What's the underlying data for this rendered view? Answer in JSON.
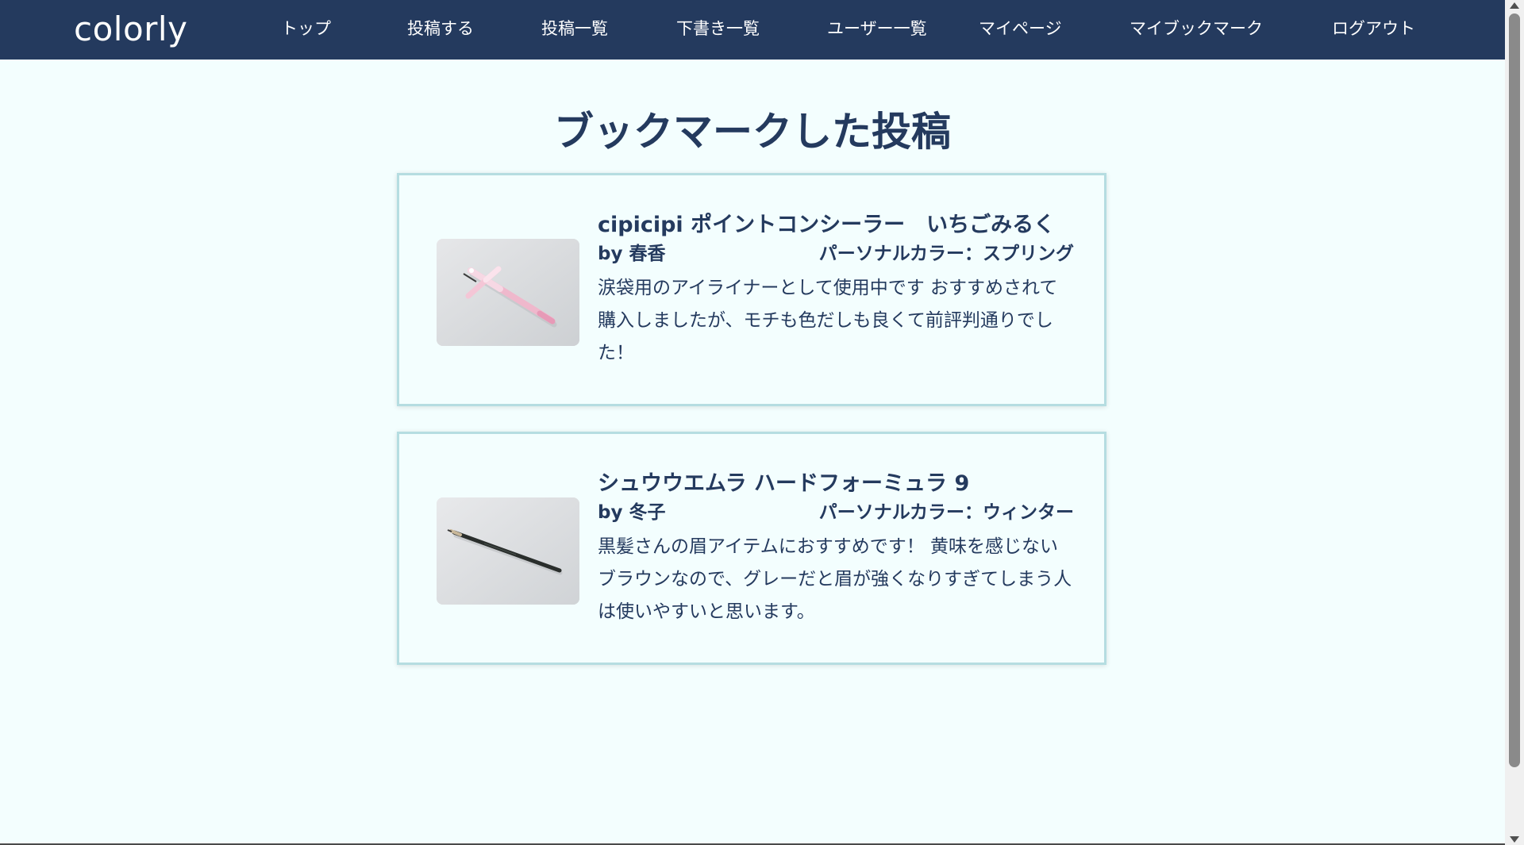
{
  "header": {
    "logo": "colorly",
    "nav": [
      {
        "label": "トップ",
        "id": "top"
      },
      {
        "label": "投稿する",
        "id": "new-post"
      },
      {
        "label": "投稿一覧",
        "id": "posts"
      },
      {
        "label": "下書き一覧",
        "id": "drafts"
      },
      {
        "label": "ユーザー一覧",
        "id": "users"
      },
      {
        "label": "マイページ",
        "id": "mypage"
      },
      {
        "label": "マイブックマーク",
        "id": "bookmarks"
      },
      {
        "label": "ログアウト",
        "id": "logout"
      }
    ]
  },
  "main": {
    "title": "ブックマークした投稿",
    "posts": [
      {
        "title": "cipicipi ポイントコンシーラー　いちごみるく",
        "author": "by 春香",
        "personal_color": "パーソナルカラー：スプリング",
        "body": "涙袋用のアイライナーとして使用中です おすすめされて購入しましたが、モチも色だしも良くて前評判通りでした！",
        "image": "pink-concealer-pen"
      },
      {
        "title": "シュウウエムラ ハードフォーミュラ 9",
        "author": "by 冬子",
        "personal_color": "パーソナルカラー：ウィンター",
        "body": "黒髪さんの眉アイテムにおすすめです！ 黄味を感じないブラウンなので、グレーだと眉が強くなりすぎてしまう人は使いやすいと思います。",
        "image": "black-eyebrow-pencil"
      }
    ]
  },
  "colors": {
    "navbar": "#243a5e",
    "background": "#f3fefe",
    "card_border": "#b5dde1",
    "text": "#243a5e"
  }
}
